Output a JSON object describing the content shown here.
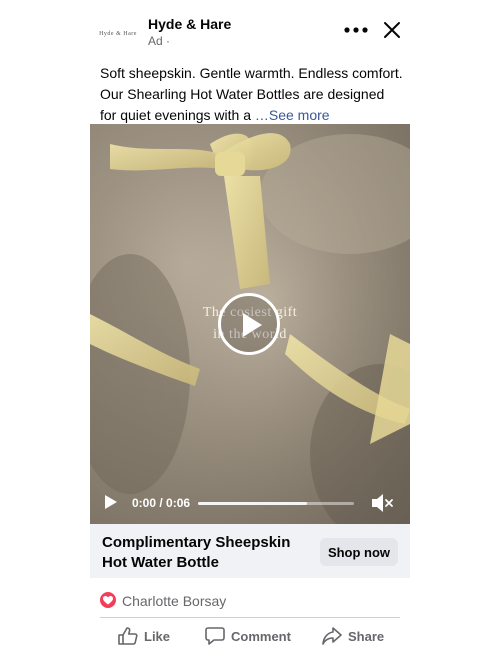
{
  "header": {
    "logo_text": "Hyde & Hare",
    "page_name": "Hyde & Hare",
    "ad_label": "Ad ·"
  },
  "caption": {
    "text": "Soft sheepskin. Gentle warmth. Endless comfort. Our Shearling Hot Water Bottles are designed for quiet evenings with a ",
    "see_more": "…See more"
  },
  "video": {
    "overlay_line1": "The cosiest gift",
    "overlay_line2": "in the world",
    "time": "0:00 / 0:06",
    "buffered_fraction": 0.7
  },
  "cta": {
    "title": "Complimentary Sheepskin Hot Water Bottle",
    "button": "Shop now"
  },
  "reactions": {
    "name": "Charlotte Borsay"
  },
  "actions": {
    "like": "Like",
    "comment": "Comment",
    "share": "Share"
  },
  "icons": {
    "more": "more-horizontal-icon",
    "close": "close-icon",
    "play": "play-icon",
    "mute": "speaker-muted-icon",
    "love": "love-reaction-icon",
    "like": "thumbs-up-icon",
    "comment": "comment-bubble-icon",
    "share": "share-arrow-icon"
  },
  "colors": {
    "link": "#385898",
    "love": "#f33e58",
    "cta_background": "#f0f2f5",
    "secondary_text": "#65676b"
  }
}
